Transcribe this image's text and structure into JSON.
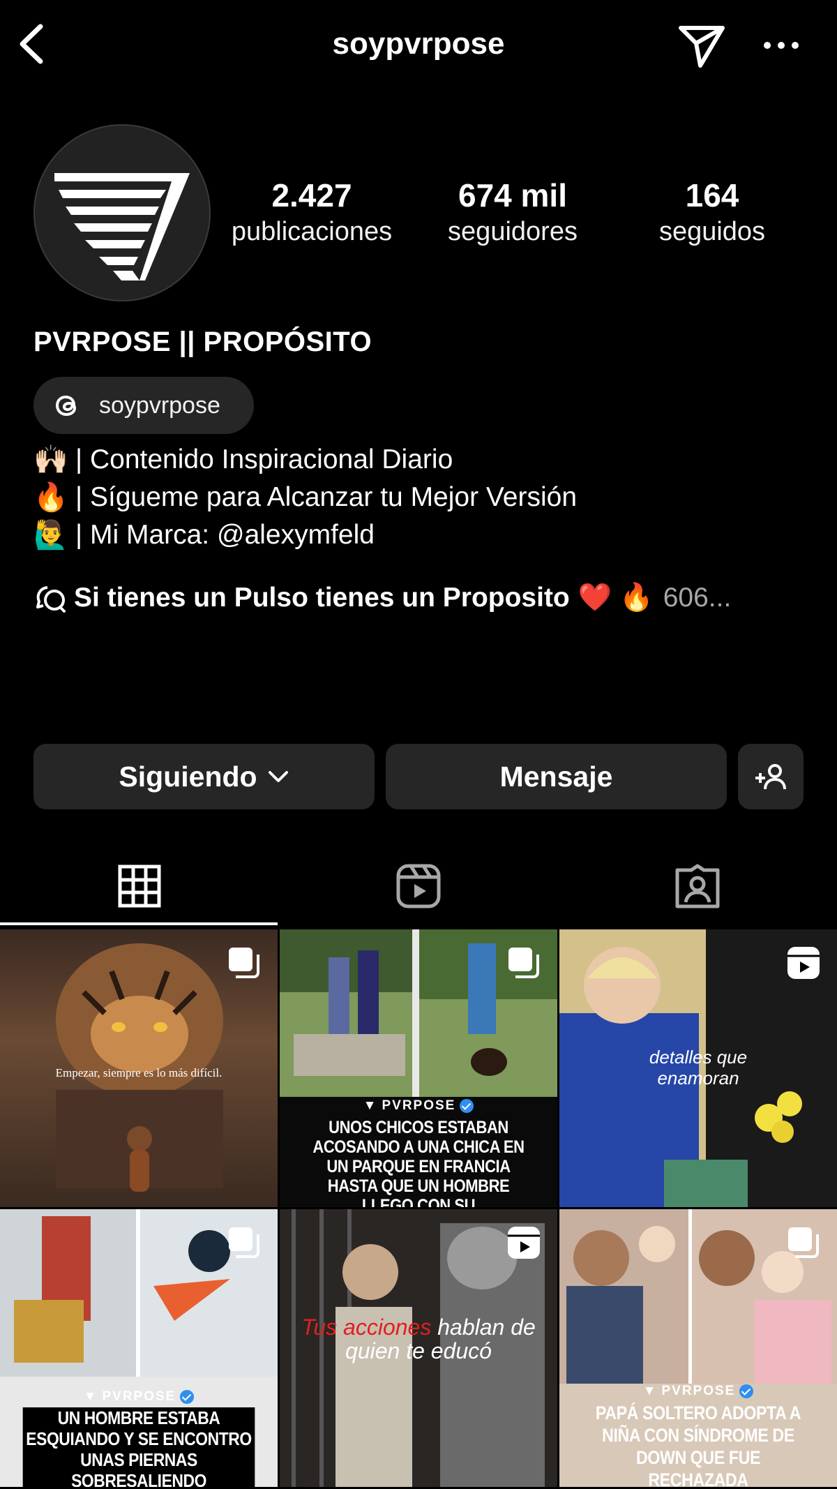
{
  "header": {
    "username": "soypvrpose",
    "icons": [
      "back-arrow-icon",
      "direct-message-icon",
      "more-options-icon"
    ]
  },
  "profile": {
    "stats": [
      {
        "value": "2.427",
        "label": "publicaciones"
      },
      {
        "value": "674 mil",
        "label": "seguidores"
      },
      {
        "value": "164",
        "label": "seguidos"
      }
    ],
    "display_name": "PVRPOSE || PROPÓSITO",
    "threads_handle": "soypvrpose",
    "bio": [
      {
        "emoji": "🙌🏻",
        "text": "| Contenido Inspiracional Diario"
      },
      {
        "emoji": "🔥",
        "text": "| Sígueme para Alcanzar tu Mejor Versión"
      },
      {
        "emoji": "🙋‍♂️",
        "text": "| Mi Marca: @alexymfeld"
      }
    ],
    "channel": {
      "title": "Si tienes un Pulso tienes un Proposito",
      "emojis": "❤️ 🔥",
      "count": "606..."
    }
  },
  "actions": {
    "following_label": "Siguiendo",
    "message_label": "Mensaje"
  },
  "tabs": [
    "posts-grid-icon",
    "reels-icon",
    "tagged-icon"
  ],
  "grid": {
    "posts": [
      {
        "type": "carousel",
        "caption": "Empezar, siempre es lo más difícil."
      },
      {
        "type": "carousel",
        "brand": "PVRPOSE",
        "caption": "UNOS CHICOS ESTABAN ACOSANDO A UNA CHICA EN UN PARQUE EN FRANCIA HASTA QUE UN HOMBRE LLEGO CON SU"
      },
      {
        "type": "reel",
        "caption": "detalles que enamoran"
      },
      {
        "type": "carousel",
        "brand": "PVRPOSE",
        "caption": "UN HOMBRE ESTABA ESQUIANDO Y SE ENCONTRO UNAS PIERNAS SOBRESALIENDO"
      },
      {
        "type": "reel",
        "caption_red": "Tus acciones",
        "caption_rest": "hablan de quien te educó"
      },
      {
        "type": "carousel",
        "brand": "PVRPOSE",
        "caption": "PAPÁ SOLTERO ADOPTA A NIÑA CON SÍNDROME DE DOWN QUE FUE RECHAZADA"
      }
    ]
  },
  "colors": {
    "background": "#000000",
    "button_bg": "#262626",
    "muted_text": "#a8a8a8",
    "verified_blue": "#2f8ff0",
    "caption_red": "#e02020"
  }
}
